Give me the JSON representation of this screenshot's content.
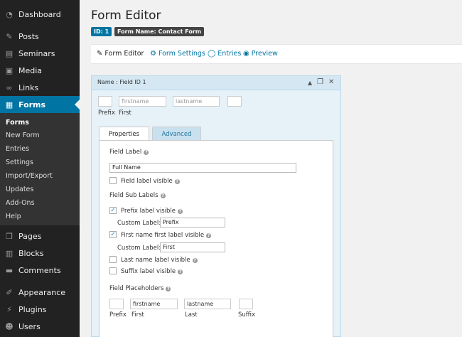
{
  "sidebar": {
    "menu": [
      {
        "label": "Dashboard",
        "icon": "dashboard-icon"
      },
      {
        "label": "Posts",
        "icon": "pin-icon"
      },
      {
        "label": "Seminars",
        "icon": "document-icon"
      },
      {
        "label": "Media",
        "icon": "media-icon"
      },
      {
        "label": "Links",
        "icon": "link-icon"
      },
      {
        "label": "Forms",
        "icon": "forms-icon"
      }
    ],
    "submenu": [
      "Forms",
      "New Form",
      "Entries",
      "Settings",
      "Import/Export",
      "Updates",
      "Add-Ons",
      "Help"
    ],
    "menu2": [
      {
        "label": "Pages",
        "icon": "pages-icon"
      },
      {
        "label": "Blocks",
        "icon": "blocks-icon"
      },
      {
        "label": "Comments",
        "icon": "comments-icon"
      },
      {
        "label": "Appearance",
        "icon": "appearance-icon"
      },
      {
        "label": "Plugins",
        "icon": "plugins-icon"
      },
      {
        "label": "Users",
        "icon": "users-icon"
      }
    ]
  },
  "page": {
    "title": "Form Editor",
    "id_badge": "ID: 1",
    "name_badge": "Form Name: Contact Form"
  },
  "toolbar": {
    "form_editor": "Form Editor",
    "form_settings": "Form Settings",
    "entries": "Entries",
    "preview": "Preview"
  },
  "field": {
    "header": "Name : Field ID 1",
    "preview": {
      "first_placeholder": "firstname",
      "last_placeholder": "lastname",
      "prefix_label": "Prefix",
      "first_label": "First"
    },
    "tabs": {
      "properties": "Properties",
      "advanced": "Advanced"
    },
    "properties": {
      "field_label_heading": "Field Label",
      "field_label_value": "Full Name",
      "field_label_visible": "Field label visible",
      "sub_labels_heading": "Field Sub Labels",
      "prefix_visible": "Prefix label visible",
      "custom_label": "Custom Label:",
      "prefix_custom": "Prefix",
      "first_visible": "First name first label visible",
      "first_custom": "First",
      "last_visible": "Last name label visible",
      "suffix_visible": "Suffix label visible",
      "placeholders_heading": "Field Placeholders",
      "ph_first": "firstname",
      "ph_last": "lastname",
      "ph_prefix_label": "Prefix",
      "ph_first_label": "First",
      "ph_last_label": "Last",
      "ph_suffix_label": "Suffix"
    }
  },
  "colors": {
    "accent": "#0074a2",
    "sidebar": "#222222",
    "panel": "#e6f1f8"
  }
}
